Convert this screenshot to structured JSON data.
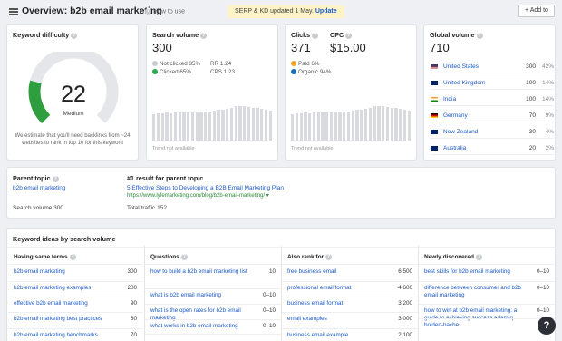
{
  "header": {
    "title": "Overview: b2b email marketing",
    "how_to_use": "How to use",
    "notice_text": "SERP & KD updated 1 May.",
    "notice_link": "Update",
    "add_button": "+ Add to"
  },
  "keyword_difficulty": {
    "title": "Keyword difficulty",
    "value": "22",
    "label": "Medium",
    "gauge_fraction": 0.22,
    "note": "We estimate that you'll need backlinks from ~24 websites to rank in top 10 for this keyword"
  },
  "search_volume": {
    "title": "Search volume",
    "value": "300",
    "not_clicked": "Not clicked 35%",
    "clicked": "Clicked 65%",
    "rr": "RR 1.24",
    "cps": "CPS 1.23",
    "trend": "Trend not available"
  },
  "clicks": {
    "title": "Clicks",
    "value": "371",
    "paid": "Paid 6%",
    "organic": "Organic 94%",
    "trend": "Trend not available"
  },
  "cpc": {
    "title": "CPC",
    "value": "$15.00"
  },
  "global_volume": {
    "title": "Global volume",
    "value": "710",
    "rows": [
      {
        "country": "United States",
        "volume": "300",
        "pct": "42%",
        "flag": "us"
      },
      {
        "country": "United Kingdom",
        "volume": "100",
        "pct": "14%",
        "flag": "uk"
      },
      {
        "country": "India",
        "volume": "100",
        "pct": "14%",
        "flag": "in"
      },
      {
        "country": "Germany",
        "volume": "70",
        "pct": "9%",
        "flag": "de"
      },
      {
        "country": "New Zealand",
        "volume": "30",
        "pct": "4%",
        "flag": "nz"
      },
      {
        "country": "Australia",
        "volume": "20",
        "pct": "2%",
        "flag": "au"
      }
    ]
  },
  "parent_topic": {
    "title": "Parent topic",
    "keyword": "b2b email marketing",
    "search_volume": "Search volume 300",
    "result_title": "#1 result for parent topic",
    "result_link": "5 Effective Steps to Developing a B2B Email Marketing Plan",
    "result_url": "https://www.lyfemarketing.com/blog/b2b-email-marketing/",
    "total_traffic": "Total traffic 152"
  },
  "ideas": {
    "title": "Keyword ideas by search volume",
    "columns": [
      {
        "heading": "Having same terms",
        "rows": [
          {
            "kw": "b2b email marketing",
            "vol": "300"
          },
          {
            "kw": "b2b email marketing examples",
            "vol": "200"
          },
          {
            "kw": "effective b2b email marketing",
            "vol": "90"
          },
          {
            "kw": "b2b email marketing best practices",
            "vol": "80"
          },
          {
            "kw": "b2b email marketing benchmarks",
            "vol": "70"
          }
        ]
      },
      {
        "heading": "Questions",
        "rows": [
          {
            "kw": "how to build a b2b email marketing list",
            "vol": "10"
          },
          {
            "kw": "what is b2b email marketing",
            "vol": "0–10"
          },
          {
            "kw": "what is the open rates for b2b email marketing",
            "vol": "0–10"
          },
          {
            "kw": "what works in b2b email marketing",
            "vol": "0–10"
          }
        ]
      },
      {
        "heading": "Also rank for",
        "rows": [
          {
            "kw": "free business email",
            "vol": "6,500"
          },
          {
            "kw": "professional email format",
            "vol": "4,600"
          },
          {
            "kw": "business email format",
            "vol": "3,200"
          },
          {
            "kw": "email examples",
            "vol": "3,000"
          },
          {
            "kw": "business email example",
            "vol": "2,100"
          }
        ]
      },
      {
        "heading": "Newly discovered",
        "rows": [
          {
            "kw": "best skills for b2b email marketing",
            "vol": "0–10"
          },
          {
            "kw": "difference between consumer and b2b email marketing",
            "vol": "0–10"
          },
          {
            "kw": "how to win at b2b email marketing: a guide to achieving success adam q. holden-bache",
            "vol": "0–10"
          }
        ]
      }
    ]
  },
  "help_fab": "?",
  "colors": {
    "accent": "#1a59c8",
    "gauge_green": "#2e9e3e",
    "paid": "#f5a623",
    "organic": "#1a6fb8",
    "not_clicked": "#c9ccd1",
    "clicked": "#2ca84d"
  }
}
